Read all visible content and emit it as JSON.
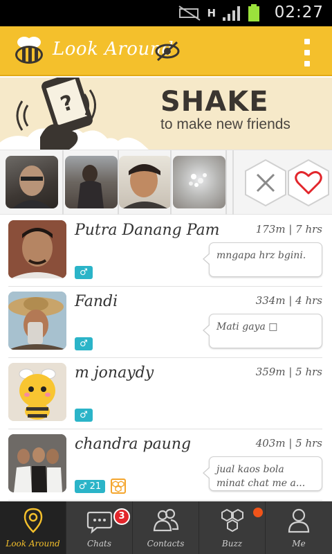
{
  "status_bar": {
    "time": "02:27",
    "network_type": "H"
  },
  "app_bar": {
    "title": "Look Around",
    "logo_icon": "bee-logo-icon",
    "visibility_icon": "eye-hidden-icon",
    "menu_icon": "overflow-menu-icon"
  },
  "banner": {
    "headline": "SHAKE",
    "subline": "to make new friends"
  },
  "photo_strip": {
    "thumbnails": [
      "photo-1",
      "photo-2",
      "photo-3",
      "photo-4"
    ],
    "reject_icon": "close-icon",
    "like_icon": "heart-icon"
  },
  "users": [
    {
      "name": "Putra Danang Pam",
      "distance": "173m",
      "time": "7 hrs",
      "gender": "♂",
      "message": "mngapa hrz bgini."
    },
    {
      "name": "Fandi",
      "distance": "334m",
      "time": "4 hrs",
      "gender": "♂",
      "message": "Mati gaya □"
    },
    {
      "name": "m jonaydy",
      "distance": "359m",
      "time": "5 hrs",
      "gender": "♂",
      "message": ""
    },
    {
      "name": "chandra paung",
      "distance": "403m",
      "time": "5 hrs",
      "gender": "♂ 21",
      "message": "jual kaos bola minat chat me a..."
    }
  ],
  "bottom_nav": [
    {
      "label": "Look Around",
      "icon": "location-pin-icon",
      "active": true
    },
    {
      "label": "Chats",
      "icon": "chat-bubble-icon",
      "badge": "3"
    },
    {
      "label": "Contacts",
      "icon": "contacts-icon"
    },
    {
      "label": "Buzz",
      "icon": "hexagons-icon"
    },
    {
      "label": "Me",
      "icon": "person-icon"
    }
  ],
  "colors": {
    "brand_yellow": "#f4c02c",
    "gender_badge": "#2bb4c8",
    "notification_red": "#e2262c",
    "buzz_dot": "#f0541a"
  }
}
